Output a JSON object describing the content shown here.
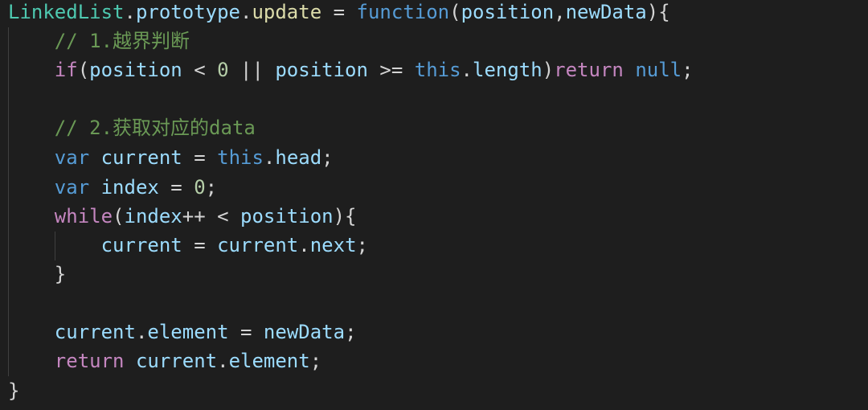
{
  "code": {
    "l1": {
      "t1": "LinkedList",
      "t2": ".",
      "t3": "prototype",
      "t4": ".",
      "t5": "update",
      "t6": " = ",
      "t7": "function",
      "t8": "(",
      "t9": "position",
      "t10": ",",
      "t11": "newData",
      "t12": "){"
    },
    "l2": {
      "t1": "    ",
      "t2": "// 1.",
      "t3": "越界判断"
    },
    "l3": {
      "t1": "    ",
      "t2": "if",
      "t3": "(",
      "t4": "position",
      "t5": " < ",
      "t6": "0",
      "t7": " || ",
      "t8": "position",
      "t9": " >= ",
      "t10": "this",
      "t11": ".",
      "t12": "length",
      "t13": ")",
      "t14": "return",
      "t15": " ",
      "t16": "null",
      "t17": ";"
    },
    "l5": {
      "t1": "    ",
      "t2": "// 2.",
      "t3": "获取对应的",
      "t4": "data"
    },
    "l6": {
      "t1": "    ",
      "t2": "var",
      "t3": " ",
      "t4": "current",
      "t5": " = ",
      "t6": "this",
      "t7": ".",
      "t8": "head",
      "t9": ";"
    },
    "l7": {
      "t1": "    ",
      "t2": "var",
      "t3": " ",
      "t4": "index",
      "t5": " = ",
      "t6": "0",
      "t7": ";"
    },
    "l8": {
      "t1": "    ",
      "t2": "while",
      "t3": "(",
      "t4": "index",
      "t5": "++ < ",
      "t6": "position",
      "t7": "){"
    },
    "l9": {
      "t1": "        ",
      "t2": "current",
      "t3": " = ",
      "t4": "current",
      "t5": ".",
      "t6": "next",
      "t7": ";"
    },
    "l10": {
      "t1": "    ",
      "t2": "}"
    },
    "l12": {
      "t1": "    ",
      "t2": "current",
      "t3": ".",
      "t4": "element",
      "t5": " = ",
      "t6": "newData",
      "t7": ";"
    },
    "l13": {
      "t1": "    ",
      "t2": "return",
      "t3": " ",
      "t4": "current",
      "t5": ".",
      "t6": "element",
      "t7": ";"
    },
    "l14": {
      "t1": "}"
    }
  }
}
